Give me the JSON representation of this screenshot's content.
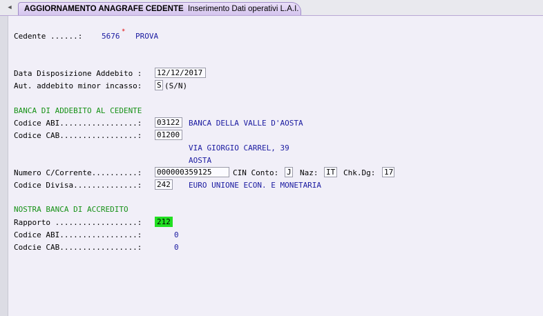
{
  "tab": {
    "title_bold": "AGGIORNAMENTO ANAGRAFE CEDENTE",
    "title_rest": "Inserimento  Dati operativi L.A.I."
  },
  "cedente": {
    "label": "Cedente ......:",
    "code": "5676",
    "name": "PROVA"
  },
  "data_disposizione": {
    "label": "Data Disposizione Addebito :",
    "value": "12/12/2017"
  },
  "aut_addebito": {
    "label": "Aut. addebito minor incasso:",
    "value": "S",
    "hint": "(S/N)"
  },
  "banca_addebito": {
    "heading": "BANCA DI ADDEBITO AL CEDENTE",
    "abi_label": "Codice ABI.................:",
    "abi_value": "03122",
    "abi_name": "BANCA DELLA VALLE D'AOSTA",
    "cab_label": "Codice CAB.................:",
    "cab_value": "01200",
    "address": "VIA GIORGIO CARREL, 39",
    "city": "AOSTA",
    "conto_label": "Numero C/Corrente..........:",
    "conto_value": "000000359125",
    "cin_label": "CIN Conto:",
    "cin_value": "J",
    "naz_label": "Naz:",
    "naz_value": "IT",
    "chk_label": "Chk.Dg:",
    "chk_value": "17",
    "divisa_label": "Codice Divisa..............:",
    "divisa_value": "242",
    "divisa_name": "EURO UNIONE ECON. E MONETARIA"
  },
  "nostra_banca": {
    "heading": "NOSTRA BANCA DI ACCREDITO",
    "rapporto_label": "Rapporto ..................:",
    "rapporto_value": "212",
    "abi_label": "Codice ABI.................:",
    "abi_value": "0",
    "cab_label": "Codcie CAB.................:",
    "cab_value": "0"
  },
  "icons": {
    "tab_scroll": "triangle-left-icon",
    "required": "asterisk-icon"
  },
  "colors": {
    "value_text": "#1a1aa0",
    "section_heading": "#169116",
    "highlight": "#22e022",
    "tab_bg": "#d4c4ee"
  }
}
